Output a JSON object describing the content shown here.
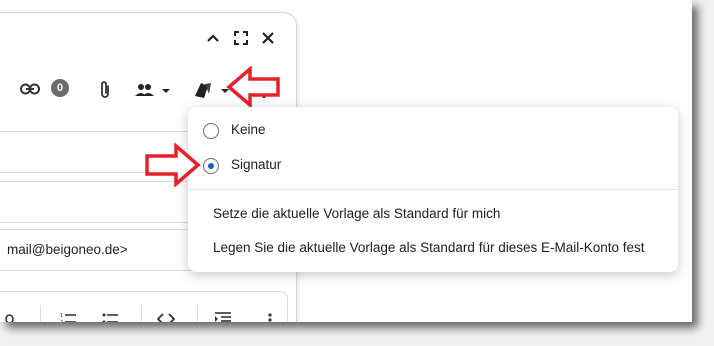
{
  "compose": {
    "link_count": "0",
    "sender_suffix": "mail@beigoneo.de>"
  },
  "signature_menu": {
    "options": [
      {
        "label": "Keine",
        "selected": false
      },
      {
        "label": "Signatur",
        "selected": true
      }
    ],
    "actions": [
      "Setze die aktuelle Vorlage als Standard für mich",
      "Legen Sie die aktuelle Vorlage als Standard für dieses E-Mail-Konto fest"
    ]
  },
  "colors": {
    "annotation_arrow": "#e8202a",
    "radio_selected": "#1a5fb4"
  },
  "icons": [
    "chevron-up-icon",
    "fullscreen-icon",
    "close-icon",
    "link-icon",
    "attachment-icon",
    "people-icon",
    "signature-icon",
    "more-vert-icon",
    "unordered-list-icon",
    "ordered-list-icon",
    "code-icon",
    "indent-icon"
  ]
}
